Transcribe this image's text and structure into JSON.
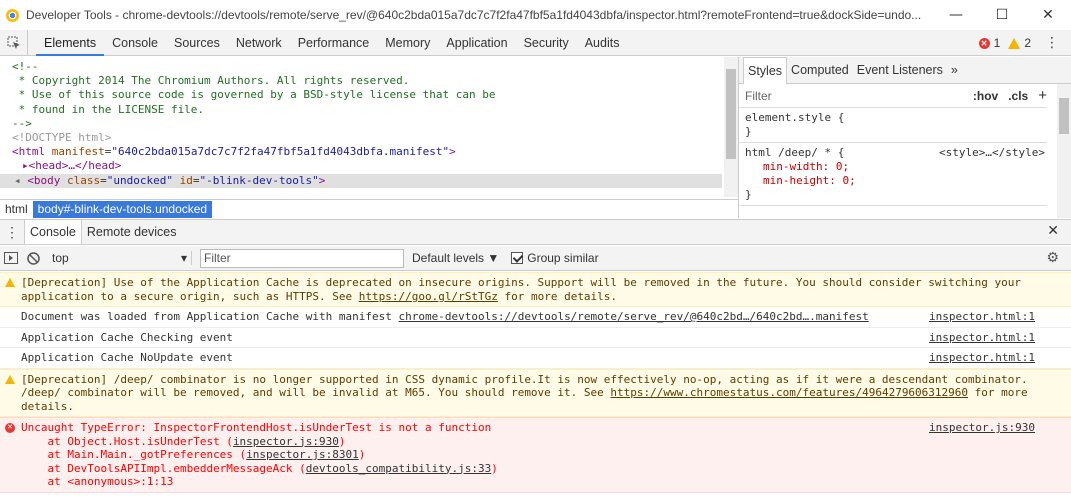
{
  "window": {
    "title": "Developer Tools - chrome-devtools://devtools/remote/serve_rev/@640c2bda015a7dc7c7f2fa47fbf5a1fd4043dbfa/inspector.html?remoteFrontend=true&dockSide=undo...",
    "minimize": "—",
    "maximize": "☐",
    "close": "✕"
  },
  "tabs": [
    "Elements",
    "Console",
    "Sources",
    "Network",
    "Performance",
    "Memory",
    "Application",
    "Security",
    "Audits"
  ],
  "counters": {
    "errors": "1",
    "warnings": "2"
  },
  "dom": {
    "comment": [
      "<!--",
      " * Copyright 2014 The Chromium Authors. All rights reserved.",
      " * Use of this source code is governed by a BSD-style license that can be",
      " * found in the LICENSE file.",
      "-->"
    ],
    "doctype": "<!DOCTYPE html>",
    "html_open": "<html",
    "html_attr_name": " manifest",
    "html_attr_value": "\"640c2bda015a7dc7c7f2fa47fbf5a1fd4043dbfa.manifest\"",
    "html_close": ">",
    "head": "▸<head>…</head>",
    "body_prefix": "<body",
    "body_class_name": " class",
    "body_class_value": "\"undocked\"",
    "body_id_name": " id",
    "body_id_value": "\"-blink-dev-tools\"",
    "body_close": ">"
  },
  "breadcrumbs": [
    "html",
    "body#-blink-dev-tools.undocked"
  ],
  "styles": {
    "tabs": [
      "Styles",
      "Computed",
      "Event Listeners",
      "»"
    ],
    "filter_placeholder": "Filter",
    "hov": ":hov",
    "cls": ".cls",
    "add": "+",
    "rule1": {
      "selector": "element.style {",
      "close": "}"
    },
    "rule2": {
      "selector": "html /deep/ * {",
      "source": "<style>…</style>",
      "props": [
        "min-width: 0;",
        "min-height: 0;"
      ],
      "close": "}"
    }
  },
  "drawer": {
    "tabs": [
      "Console",
      "Remote devices"
    ],
    "close": "✕"
  },
  "toolbar": {
    "context": "top",
    "filter_placeholder": "Filter",
    "levels": "Default levels ▼",
    "group_similar": "Group similar"
  },
  "messages": [
    {
      "level": "warn",
      "text_a": "[Deprecation] Use of the Application Cache is deprecated on insecure origins. Support will be removed in the future. You should consider switching your application to a secure origin, such as HTTPS. See ",
      "link": "https://goo.gl/rStTGz",
      "text_b": " for more details.",
      "source": ""
    },
    {
      "level": "info",
      "text_a": "Document was loaded from Application Cache with manifest ",
      "link": "chrome-devtools://devtools/remote/serve_rev/@640c2bd…/640c2bd….manifest",
      "text_b": "",
      "source": "inspector.html:1"
    },
    {
      "level": "info",
      "text_a": "Application Cache Checking event",
      "link": "",
      "text_b": "",
      "source": "inspector.html:1"
    },
    {
      "level": "info",
      "text_a": "Application Cache NoUpdate event",
      "link": "",
      "text_b": "",
      "source": "inspector.html:1"
    },
    {
      "level": "warn",
      "text_a": "[Deprecation] /deep/ combinator is no longer supported in CSS dynamic profile.It is now effectively no-op, acting as if it were a descendant combinator. /deep/ combinator will be removed, and will be invalid at M65. You should remove it. See ",
      "link": "https://www.chromestatus.com/features/4964279606312960",
      "text_b": " for more details.",
      "source": ""
    }
  ],
  "error": {
    "title": "Uncaught TypeError: InspectorFrontendHost.isUnderTest is not a function",
    "source": "inspector.js:930",
    "stack": [
      {
        "prefix": "    at Object.Host.isUnderTest (",
        "link": "inspector.js:930",
        "suffix": ")"
      },
      {
        "prefix": "    at Main.Main._gotPreferences (",
        "link": "inspector.js:8301",
        "suffix": ")"
      },
      {
        "prefix": "    at DevToolsAPIImpl.embedderMessageAck (",
        "link": "devtools_compatibility.js:33",
        "suffix": ")"
      },
      {
        "prefix": "    at <anonymous>:1:13",
        "link": "",
        "suffix": ""
      }
    ]
  },
  "colors": {
    "accent": "#3879d9",
    "warning_bg": "#fffbe6",
    "error_bg": "#fff0f0"
  }
}
